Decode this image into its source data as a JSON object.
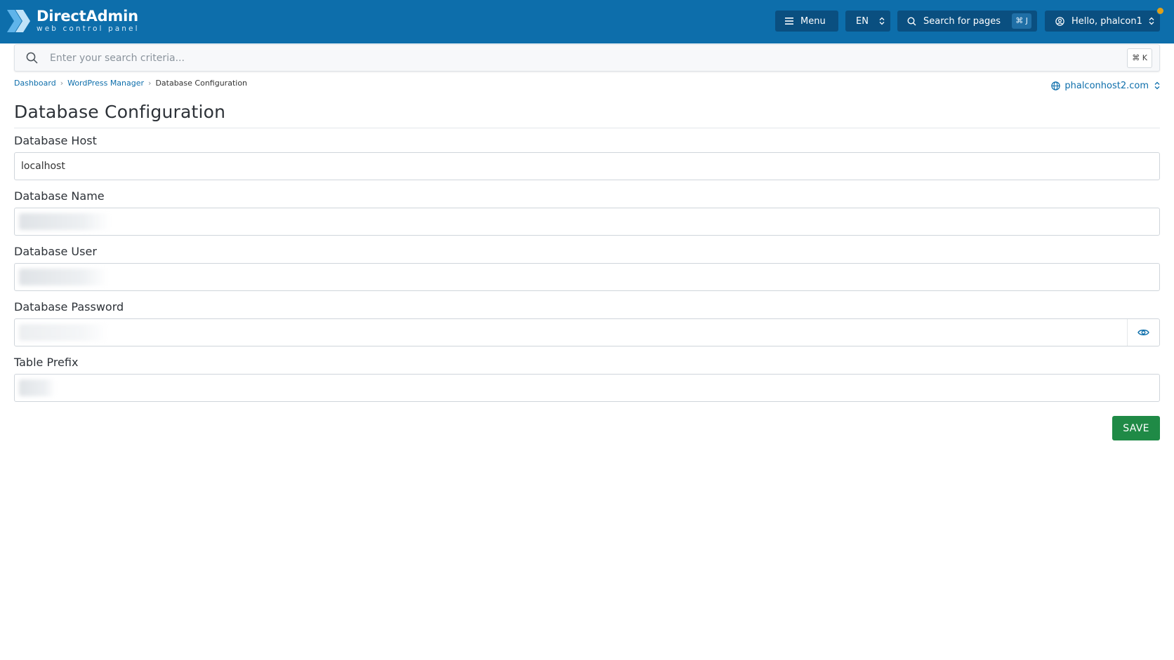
{
  "app": {
    "logo_title": "DirectAdmin",
    "logo_subtitle": "web control panel",
    "accent_color": "#0d6eab"
  },
  "header": {
    "menu_label": "Menu",
    "language": "EN",
    "search_pages_label": "Search for pages",
    "search_pages_shortcut": "⌘ J",
    "user_greeting": "Hello, phalcon1"
  },
  "search": {
    "placeholder": "Enter your search criteria...",
    "shortcut": "⌘ K"
  },
  "breadcrumb": {
    "items": [
      "Dashboard",
      "WordPress Manager",
      "Database Configuration"
    ]
  },
  "domain_selector": {
    "value": "phalconhost2.com"
  },
  "page": {
    "title": "Database Configuration"
  },
  "form": {
    "host_label": "Database Host",
    "host_value": "localhost",
    "name_label": "Database Name",
    "user_label": "Database User",
    "password_label": "Database Password",
    "prefix_label": "Table Prefix",
    "save_label": "SAVE"
  },
  "icons": {
    "logo": "directadmin-logo-icon",
    "menu": "hamburger-icon",
    "search": "search-icon",
    "user": "user-circle-icon",
    "domain": "globe-icon",
    "password_toggle": "eye-icon"
  }
}
